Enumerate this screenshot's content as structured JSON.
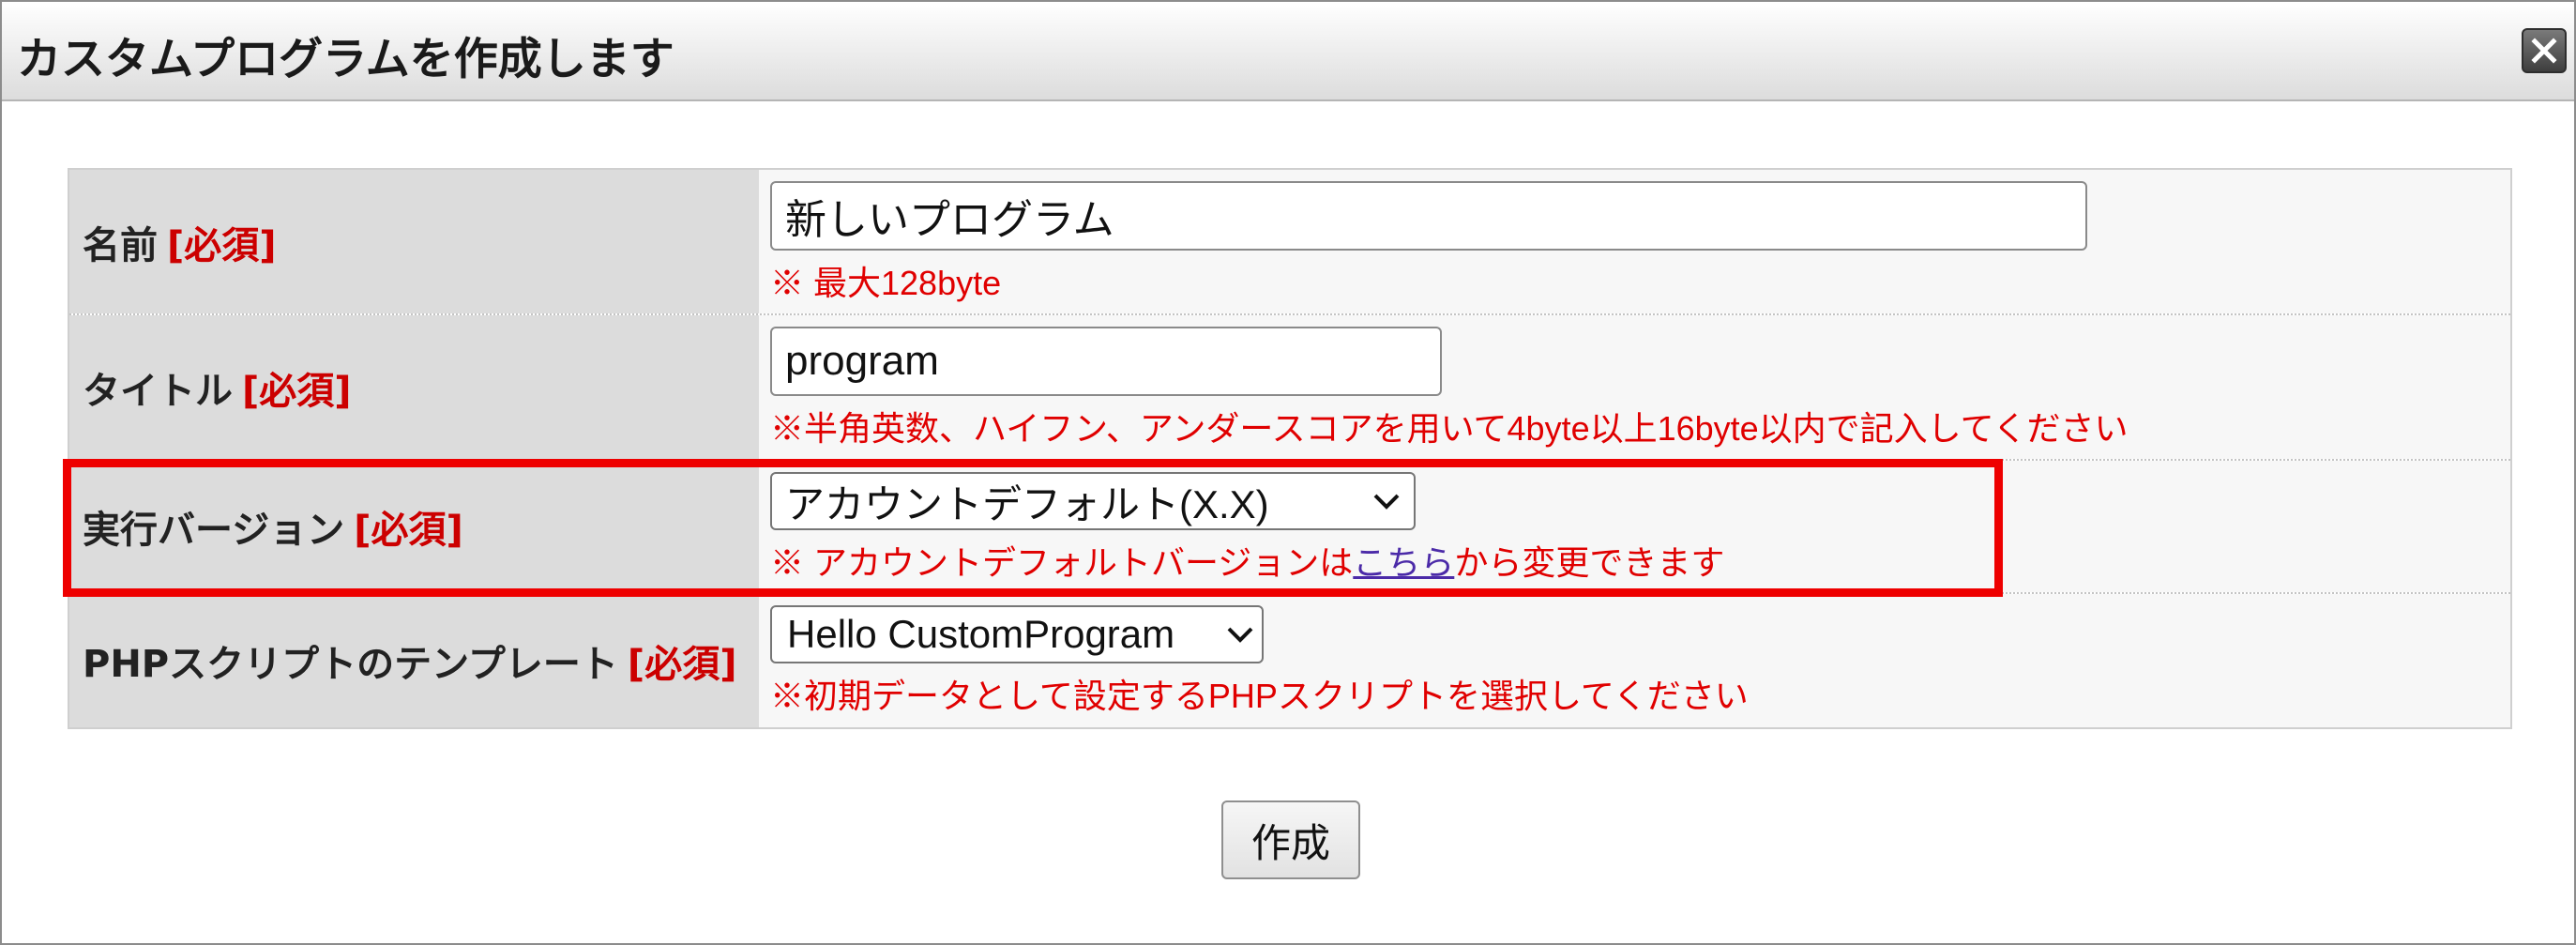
{
  "dialog": {
    "title": "カスタムプログラムを作成します",
    "close_icon": "close-icon"
  },
  "form": {
    "required_tag": "[必須]",
    "name": {
      "label": "名前",
      "value": "新しいプログラム",
      "note": "※ 最大128byte"
    },
    "title_field": {
      "label": "タイトル",
      "value": "program",
      "note": "※半角英数、ハイフン、アンダースコアを用いて4byte以上16byte以内で記入してください"
    },
    "version": {
      "label": "実行バージョン",
      "selected": "アカウントデフォルト(X.X)",
      "note_prefix": "※ アカウントデフォルトバージョンは",
      "note_link": "こちら",
      "note_suffix": "から変更できます"
    },
    "template": {
      "label": "PHPスクリプトのテンプレート",
      "selected": "Hello CustomProgram",
      "note": "※初期データとして設定するPHPスクリプトを選択してください"
    }
  },
  "actions": {
    "submit_label": "作成"
  },
  "colors": {
    "required": "#cc0000",
    "note": "#e00000",
    "link": "#4b2aa8",
    "highlight": "#ee0000"
  }
}
